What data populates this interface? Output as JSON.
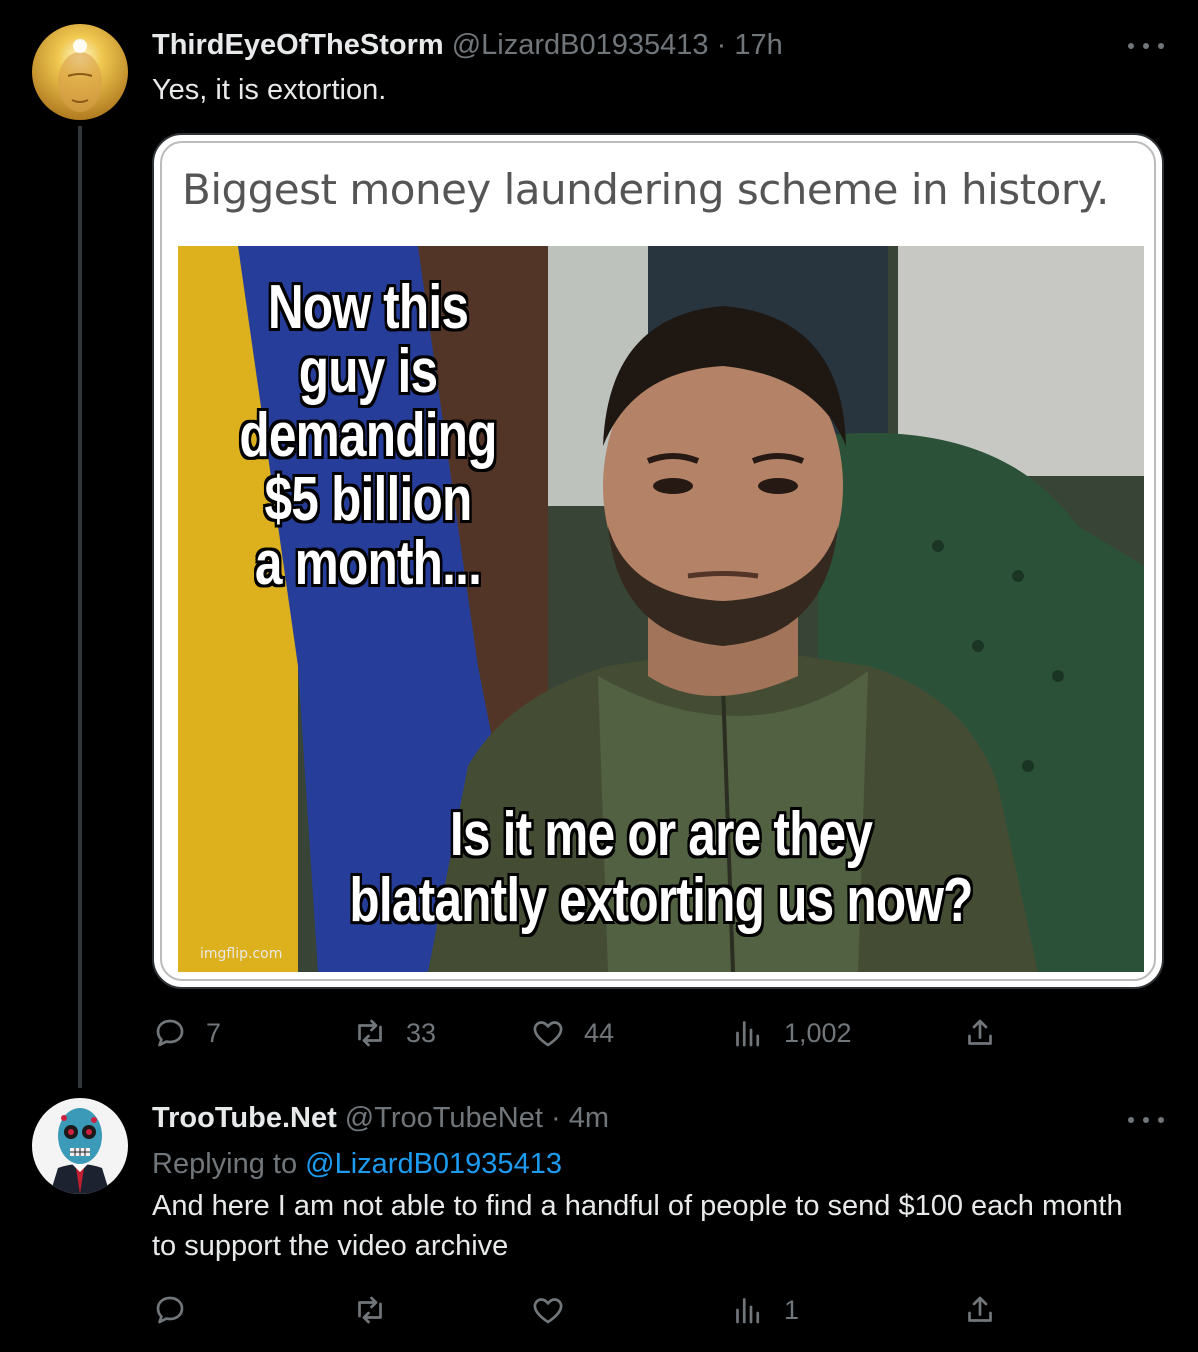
{
  "tweets": [
    {
      "author": {
        "name": "ThirdEyeOfTheStorm",
        "handle": "@LizardB01935413",
        "time": "17h"
      },
      "separator": "·",
      "text": "Yes, it is extortion.",
      "media": {
        "title": "Biggest money laundering scheme in history.",
        "caption_top_lines": [
          "Now this",
          "guy is",
          "demanding",
          "$5 billion",
          "a month..."
        ],
        "caption_bottom_lines": [
          "Is it me or are they",
          "blatantly extorting us now?"
        ],
        "watermark": "imgflip.com"
      },
      "stats": {
        "replies": "7",
        "retweets": "33",
        "likes": "44",
        "views": "1,002"
      }
    },
    {
      "author": {
        "name": "TrooTube.Net",
        "handle": "@TrooTubeNet",
        "time": "4m"
      },
      "separator": "·",
      "replying_label": "Replying to",
      "replying_to": "@LizardB01935413",
      "text": "And here I am not able to find a handful of people to send $100 each month to support the video archive",
      "stats": {
        "replies": "",
        "retweets": "",
        "likes": "",
        "views": "1"
      }
    }
  ],
  "colors": {
    "background": "#000000",
    "text": "#e7e9ea",
    "muted": "#71767b",
    "link": "#1d9bf0",
    "line": "#333639"
  },
  "icons": [
    "more-icon",
    "reply-icon",
    "retweet-icon",
    "like-icon",
    "views-icon",
    "share-icon"
  ]
}
